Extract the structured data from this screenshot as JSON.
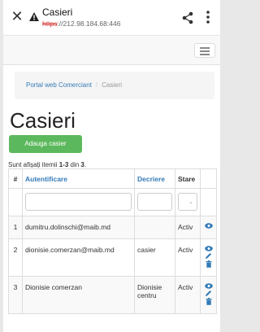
{
  "browser": {
    "title": "Casieri",
    "url_scheme": "https",
    "url_rest": "://212.98.184.68:446",
    "icons": [
      "close-icon",
      "warning-icon",
      "share-icon",
      "kebab-menu-icon"
    ]
  },
  "navbar": {
    "menu_icon": "hamburger-icon"
  },
  "breadcrumb": {
    "home": "Portal web Comerciant",
    "separator": "/",
    "current": "Casieri"
  },
  "page": {
    "title": "Casieri",
    "add_button": "Adauga casier",
    "summary_prefix": "Sunt afișați itemii ",
    "summary_range": "1-3",
    "summary_mid": " din ",
    "summary_total": "3",
    "summary_end": "."
  },
  "table": {
    "headers": {
      "num": "#",
      "auth": "Autentificare",
      "desc": "Decriere",
      "state": "Stare"
    },
    "rows": [
      {
        "num": "1",
        "auth": "dumitru.dolinschi@maib.md",
        "desc": "",
        "state": "Activ"
      },
      {
        "num": "2",
        "auth": "dionisie.comerzan@maib.md",
        "desc": "casier",
        "state": "Activ"
      },
      {
        "num": "3",
        "auth": "Dionisie comerzan",
        "desc": "Dionisie centru",
        "state": "Activ"
      }
    ]
  },
  "colors": {
    "link": "#337ab7",
    "success": "#5cb85c",
    "danger_url": "#d32f2f"
  }
}
